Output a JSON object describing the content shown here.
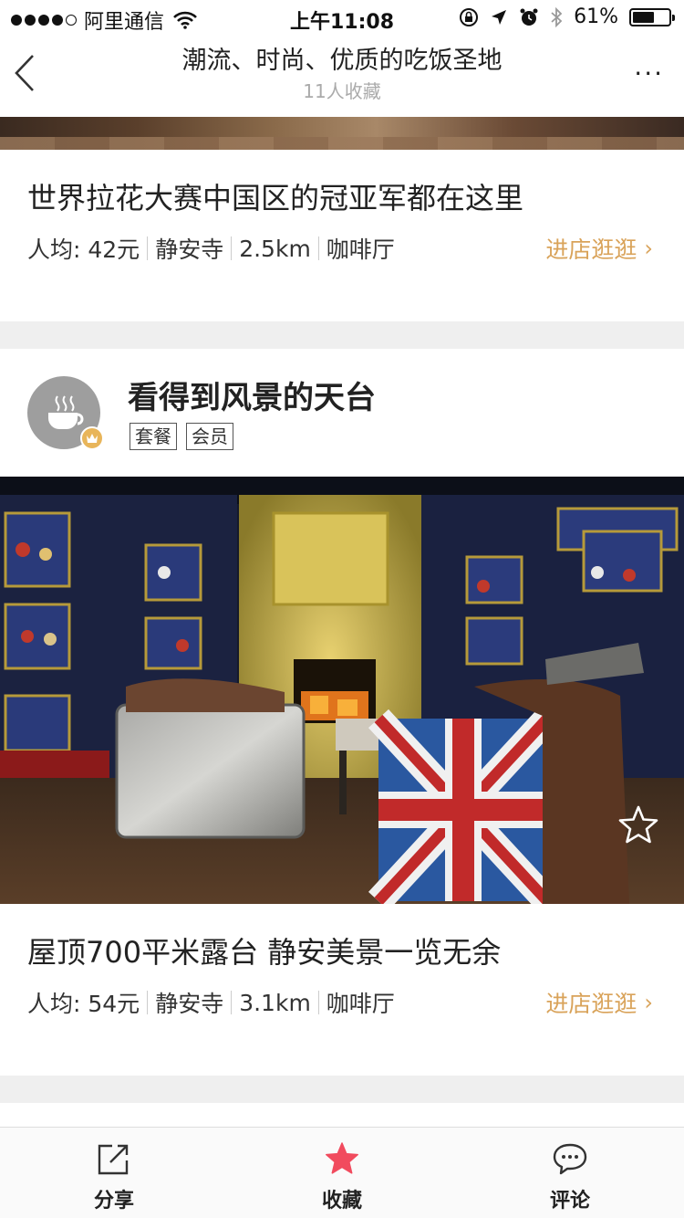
{
  "status_bar": {
    "carrier": "阿里通信",
    "time": "上午11:08",
    "battery": "61%",
    "battery_level": 0.61,
    "icons": [
      "wifi-icon",
      "orientation-lock-icon",
      "location-icon",
      "alarm-icon",
      "bluetooth-icon",
      "battery-icon"
    ]
  },
  "nav": {
    "title": "潮流、时尚、优质的吃饭圣地",
    "subtitle": "11人收藏",
    "back_icon": "chevron-left-icon",
    "more_label": "···"
  },
  "card1": {
    "title": "世界拉花大赛中国区的冠亚军都在这里",
    "price": "人均: 42元",
    "area": "静安寺",
    "distance": "2.5km",
    "category": "咖啡厅",
    "visit_label": "进店逛逛",
    "visit_chevron": "›"
  },
  "section": {
    "name": "看得到风景的天台",
    "tags": [
      "套餐",
      "会员"
    ],
    "avatar_icon": "coffee-cup-icon",
    "badge_icon": "crown-icon"
  },
  "card2": {
    "title": "屋顶700平米露台 静安美景一览无余",
    "price": "人均: 54元",
    "area": "静安寺",
    "distance": "3.1km",
    "category": "咖啡厅",
    "visit_label": "进店逛逛",
    "visit_chevron": "›",
    "favorite_icon": "star-outline-icon"
  },
  "tabbar": {
    "share_label": "分享",
    "collect_label": "收藏",
    "comment_label": "评论"
  },
  "colors": {
    "accent": "#d9a35a",
    "favorite": "#f14b5e",
    "divider": "#efefef"
  }
}
